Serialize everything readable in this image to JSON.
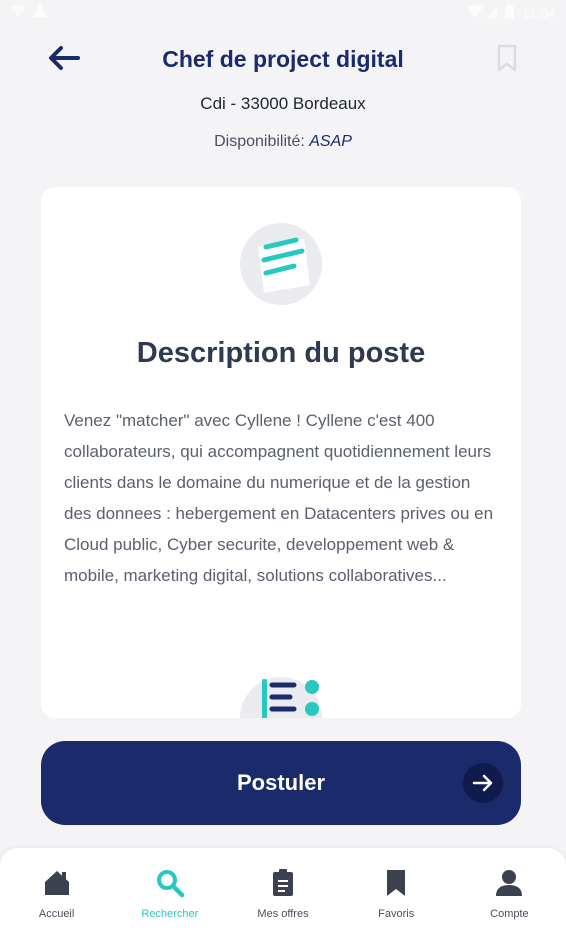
{
  "status_bar": {
    "time": "11:04"
  },
  "header": {
    "title": "Chef de project digital",
    "subtitle": "Cdi - 33000 Bordeaux",
    "availability_label": "Disponibilité: ",
    "availability_value": "ASAP"
  },
  "card": {
    "title": "Description du poste",
    "text": "Venez \"matcher\" avec Cyllene ! Cyllene c'est 400 collaborateurs, qui accompagnent quotidiennement leurs clients dans le domaine du numerique et de la gestion des donnees : hebergement en Datacenters prives ou en Cloud public, Cyber securite, developpement web & mobile, marketing digital, solutions collaboratives..."
  },
  "apply_button": {
    "label": "Postuler"
  },
  "tabs": [
    {
      "label": "Accueil",
      "icon": "home-icon"
    },
    {
      "label": "Rechercher",
      "icon": "search-icon"
    },
    {
      "label": "Mes offres",
      "icon": "clipboard-icon"
    },
    {
      "label": "Favoris",
      "icon": "bookmark-icon"
    },
    {
      "label": "Compte",
      "icon": "user-icon"
    }
  ],
  "colors": {
    "primary": "#1b2a6b",
    "accent": "#27c8c0",
    "background": "#f4f4f6",
    "tab_icon": "#3c4150"
  }
}
